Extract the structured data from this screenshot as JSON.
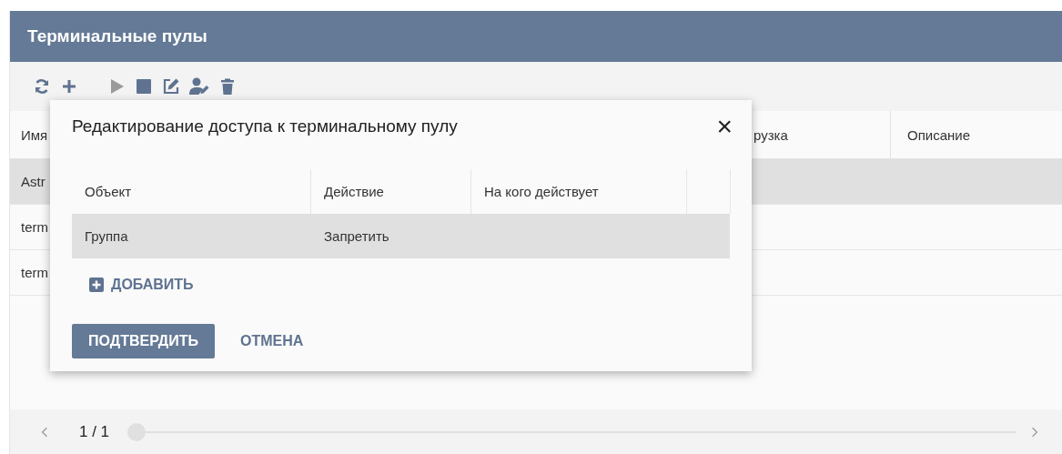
{
  "page": {
    "title": "Терминальные пулы"
  },
  "toolbar": [
    {
      "kind": "refresh",
      "disabled": false
    },
    {
      "kind": "add",
      "disabled": false
    },
    {
      "kind": "start",
      "disabled": true
    },
    {
      "kind": "stop",
      "disabled": false
    },
    {
      "kind": "edit",
      "disabled": false
    },
    {
      "kind": "user-edit",
      "disabled": false
    },
    {
      "kind": "delete",
      "disabled": false
    }
  ],
  "table": {
    "columns": [
      "Имя",
      "рузка",
      "Описание"
    ],
    "rows": [
      {
        "name": "Astr",
        "selected": true
      },
      {
        "name": "term",
        "selected": false
      },
      {
        "name": "term",
        "selected": false
      }
    ]
  },
  "pagination": {
    "page": "1 / 1",
    "level": 0
  },
  "dialog": {
    "title": "Редактирование доступа к терминальному пулу",
    "close": "×",
    "columns": [
      "Объект",
      "Действие",
      "На кого действует"
    ],
    "rows": [
      {
        "cells": [
          "Группа",
          "Запретить",
          ""
        ],
        "selected": true
      }
    ],
    "add_label": "ДОБАВИТЬ",
    "confirm": "ПОДТВЕРДИТЬ",
    "cancel": "ОТМЕНА"
  }
}
